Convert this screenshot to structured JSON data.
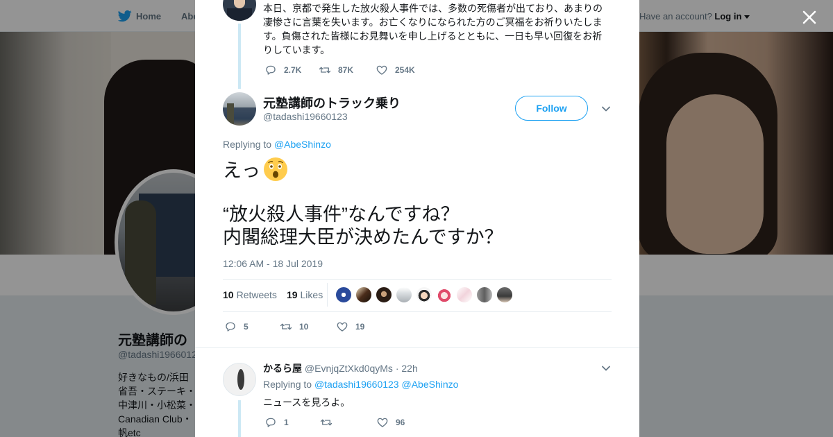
{
  "background": {
    "nav": {
      "home": "Home",
      "about": "Abo",
      "account_q": "Have an account?",
      "login": "Log in"
    },
    "profile": {
      "name": "元塾講師の",
      "handle": "@tadashi1966012",
      "bio": "好きなもの/浜田省吾・ステーキ・中津川・小松菜・Canadian Club・帆etc"
    }
  },
  "modal": {
    "parent_tweet": {
      "text": "本日、京都で発生した放火殺人事件では、多数の死傷者が出ており、あまりの凄惨さに言葉を失います。お亡くなりになられた方のご冥福をお祈りいたします。負傷された皆様にお見舞いを申し上げるとともに、一日も早い回復をお祈りしています。",
      "replies": "2.7K",
      "retweets": "87K",
      "likes": "254K"
    },
    "main_tweet": {
      "author_name": "元塾講師のトラック乗り",
      "author_handle": "@tadashi19660123",
      "follow_label": "Follow",
      "replying_prefix": "Replying to",
      "replying_handle": "@AbeShinzo",
      "line1": "えっ",
      "line2": "“放火殺人事件”なんですね？",
      "line3": "内閣総理大臣が決めたんですか？",
      "timestamp": "12:06 AM - 18 Jul 2019",
      "retweets_count": "10",
      "retweets_label": "Retweets",
      "likes_count": "19",
      "likes_label": "Likes",
      "replies": "5",
      "retweets": "10",
      "likes": "19"
    },
    "reply_tweet": {
      "author_name": "かるら屋",
      "author_handle": "@EvnjqZtXkd0qyMs",
      "time": "· 22h",
      "replying_prefix": "Replying to",
      "replying_handle1": "@tadashi19660123",
      "replying_handle2": "@AbeShinzo",
      "text": "ニュースを見ろよ。",
      "replies": "1",
      "retweets": "",
      "likes": "96"
    }
  },
  "icons": {
    "close": "close-icon",
    "reply": "reply-icon",
    "retweet": "retweet-icon",
    "like": "heart-icon",
    "chevron": "chevron-down-icon",
    "bird": "twitter-bird-icon",
    "emoji": "astonished-face-icon"
  },
  "colors": {
    "accent": "#1da1f2",
    "muted": "#657786",
    "text": "#14171a"
  }
}
